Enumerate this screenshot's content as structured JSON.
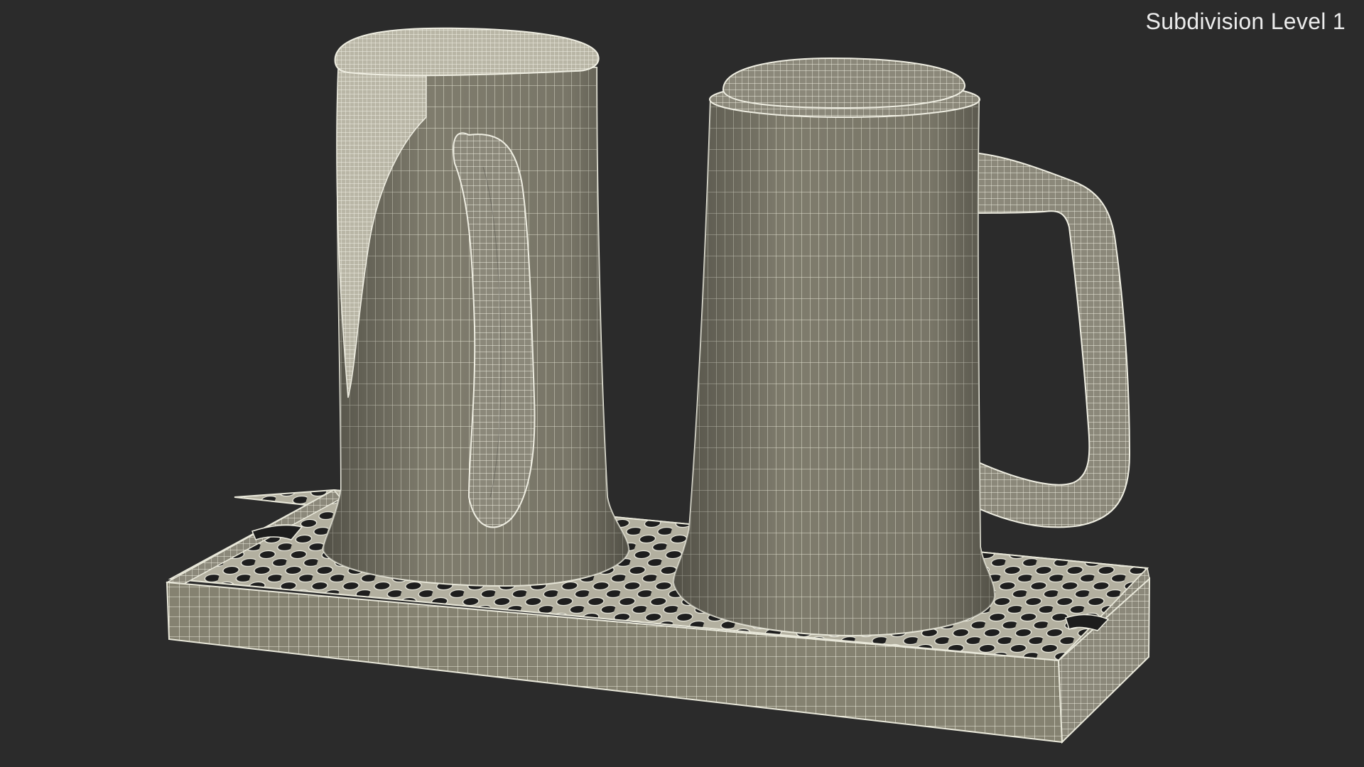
{
  "viewport": {
    "label": "Subdivision Level 1",
    "background_color": "#2b2b2b",
    "mesh_fill_color": "#8e8b7c",
    "wire_color": "#e8e6d6"
  },
  "scene": {
    "objects": [
      {
        "name": "beer-mug-with-foam",
        "description_visible": false
      },
      {
        "name": "beer-mug-empty",
        "description_visible": false
      },
      {
        "name": "drip-tray",
        "description_visible": false
      }
    ]
  }
}
